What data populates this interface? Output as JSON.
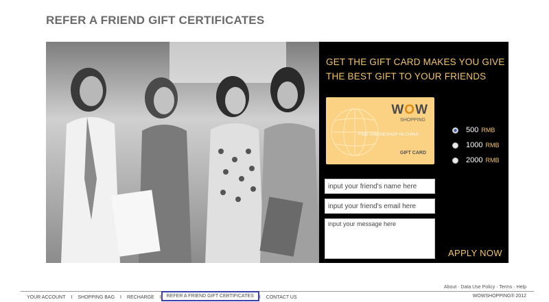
{
  "page": {
    "title": "REFER A FRIEND GIFT CERTIFICATES"
  },
  "promo": {
    "headline_line1": "GET THE GIFT CARD MAKES YOU GIVE",
    "headline_line2": "THE BEST GIFT TO YOUR FRIENDS"
  },
  "gift_card": {
    "brand_w1": "W",
    "brand_o": "O",
    "brand_w2": "W",
    "brand_sub": "SHOPPING",
    "tagline": "FIND ONLINESHOP IN CHINA",
    "type": "GIFT CARD"
  },
  "amounts": [
    {
      "value": "500",
      "unit": "RMB",
      "selected": true
    },
    {
      "value": "1000",
      "unit": "RMB",
      "selected": false
    },
    {
      "value": "2000",
      "unit": "RMB",
      "selected": false
    }
  ],
  "form": {
    "name_placeholder": "input your friend's name here",
    "email_placeholder": "input your friend's email here",
    "message_placeholder": "input your message here",
    "apply_label": "APPLY NOW"
  },
  "footer": {
    "top_links": "About · Data Use Policy · Terms · Help",
    "nav": [
      {
        "label": "YOUR ACCOUNT"
      },
      {
        "label": "SHOPPING BAG"
      },
      {
        "label": "RECHARGE"
      },
      {
        "label": "REFER A FRIEND GIFT CERTIFICATES",
        "active": true
      },
      {
        "label": "CONTACT US"
      }
    ],
    "separator": "I",
    "copyright": "WOWSHOPPING® 2012"
  },
  "colors": {
    "accent_gold": "#f2c56a",
    "card_bg": "#fbd184",
    "active_nav_border": "#3a3fae"
  }
}
